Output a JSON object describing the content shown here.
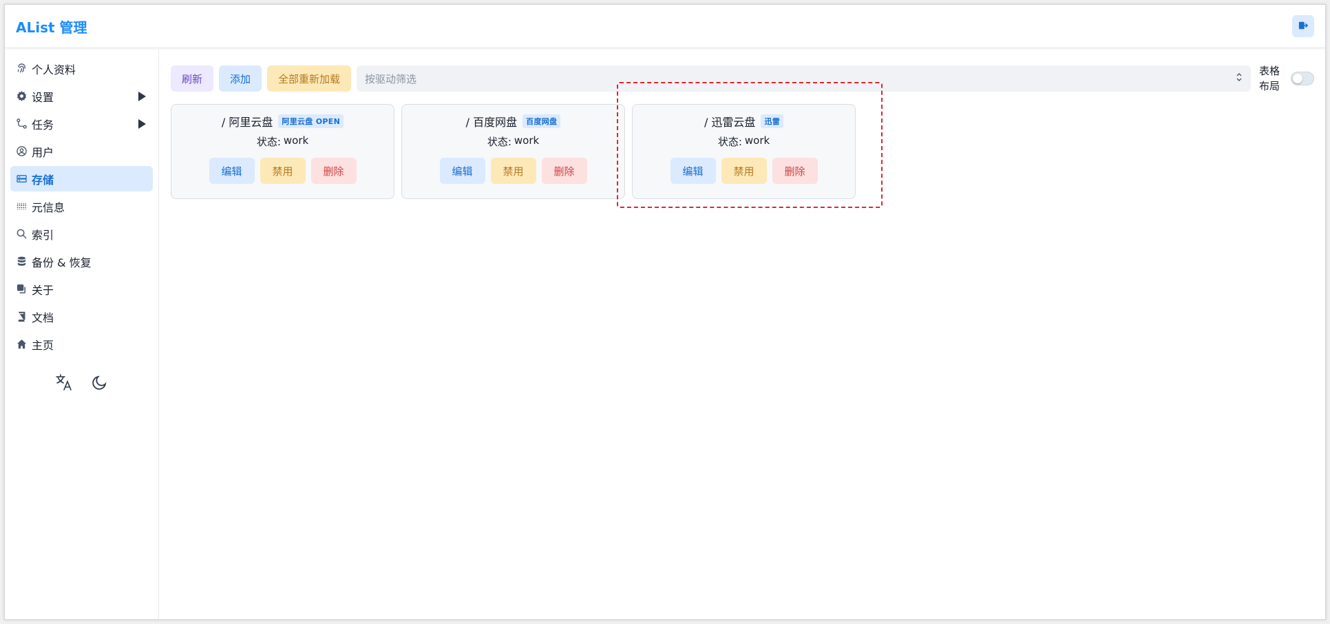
{
  "header": {
    "brand": "AList 管理",
    "logout_icon": "logout-icon"
  },
  "sidebar": {
    "items": [
      {
        "label": "个人资料",
        "icon": "fingerprint-icon",
        "has_arrow": false,
        "active": false
      },
      {
        "label": "设置",
        "icon": "gear-icon",
        "has_arrow": true,
        "active": false
      },
      {
        "label": "任务",
        "icon": "flow-icon",
        "has_arrow": true,
        "active": false
      },
      {
        "label": "用户",
        "icon": "user-circle-icon",
        "has_arrow": false,
        "active": false
      },
      {
        "label": "存储",
        "icon": "storage-icon",
        "has_arrow": false,
        "active": true
      },
      {
        "label": "元信息",
        "icon": "meta-icon",
        "has_arrow": false,
        "active": false
      },
      {
        "label": "索引",
        "icon": "search-icon",
        "has_arrow": false,
        "active": false
      },
      {
        "label": "备份 & 恢复",
        "icon": "database-icon",
        "has_arrow": false,
        "active": false
      },
      {
        "label": "关于",
        "icon": "copy-icon",
        "has_arrow": false,
        "active": false
      },
      {
        "label": "文档",
        "icon": "book-icon",
        "has_arrow": false,
        "active": false
      },
      {
        "label": "主页",
        "icon": "home-icon",
        "has_arrow": false,
        "active": false
      }
    ],
    "tools": {
      "translate_icon": "translate-icon",
      "theme_icon": "moon-icon"
    }
  },
  "toolbar": {
    "refresh_label": "刷新",
    "add_label": "添加",
    "reload_all_label": "全部重新加载",
    "filter_placeholder": "按驱动筛选",
    "layout_label": "表格布局",
    "layout_toggle_on": false
  },
  "storages": [
    {
      "mount_path": "/ 阿里云盘",
      "driver": "阿里云盘 OPEN",
      "status_label": "状态:",
      "status": "work",
      "edit": "编辑",
      "disable": "禁用",
      "delete": "删除"
    },
    {
      "mount_path": "/ 百度网盘",
      "driver": "百度网盘",
      "status_label": "状态:",
      "status": "work",
      "edit": "编辑",
      "disable": "禁用",
      "delete": "删除"
    },
    {
      "mount_path": "/ 迅雷云盘",
      "driver": "迅雷",
      "status_label": "状态:",
      "status": "work",
      "edit": "编辑",
      "disable": "禁用",
      "delete": "删除"
    }
  ],
  "colors": {
    "brand": "#1a8cff",
    "highlight": "#e0242b"
  }
}
